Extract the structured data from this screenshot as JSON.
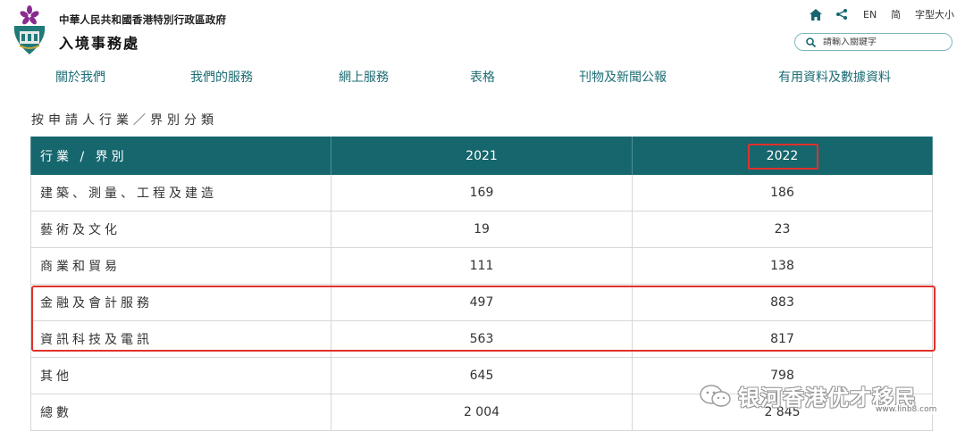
{
  "header": {
    "gov_name": "中華人民共和國香港特別行政區政府",
    "dept_name": "入境事務處",
    "utilities": {
      "en": "EN",
      "sc": "简",
      "font_size": "字型大小"
    },
    "search": {
      "placeholder": "請輸入關鍵字",
      "value": ""
    }
  },
  "nav": {
    "items": [
      {
        "label": "關於我們"
      },
      {
        "label": "我們的服務"
      },
      {
        "label": "網上服務"
      },
      {
        "label": "表格"
      },
      {
        "label": "刊物及新聞公報"
      },
      {
        "label": "有用資料及數據資料"
      }
    ]
  },
  "section_title": "按申請人行業／界別分類",
  "table": {
    "headers": [
      "行業 / 界別",
      "2021",
      "2022"
    ],
    "rows": [
      {
        "sector": "建築、測量、工程及建造",
        "y2021": "169",
        "y2022": "186"
      },
      {
        "sector": "藝術及文化",
        "y2021": "19",
        "y2022": "23"
      },
      {
        "sector": "商業和貿易",
        "y2021": "111",
        "y2022": "138"
      },
      {
        "sector": "金融及會計服務",
        "y2021": "497",
        "y2022": "883"
      },
      {
        "sector": "資訊科技及電訊",
        "y2021": "563",
        "y2022": "817"
      },
      {
        "sector": "其他",
        "y2021": "645",
        "y2022": "798"
      },
      {
        "sector": "總數",
        "y2021": "2 004",
        "y2022": "2 845"
      }
    ]
  },
  "watermark": {
    "text": "银河香港优才移民",
    "url": "www.linb8.com"
  },
  "colors": {
    "header_bg": "#16666d",
    "nav_text": "#1d6d74",
    "highlight": "#e0312b"
  }
}
